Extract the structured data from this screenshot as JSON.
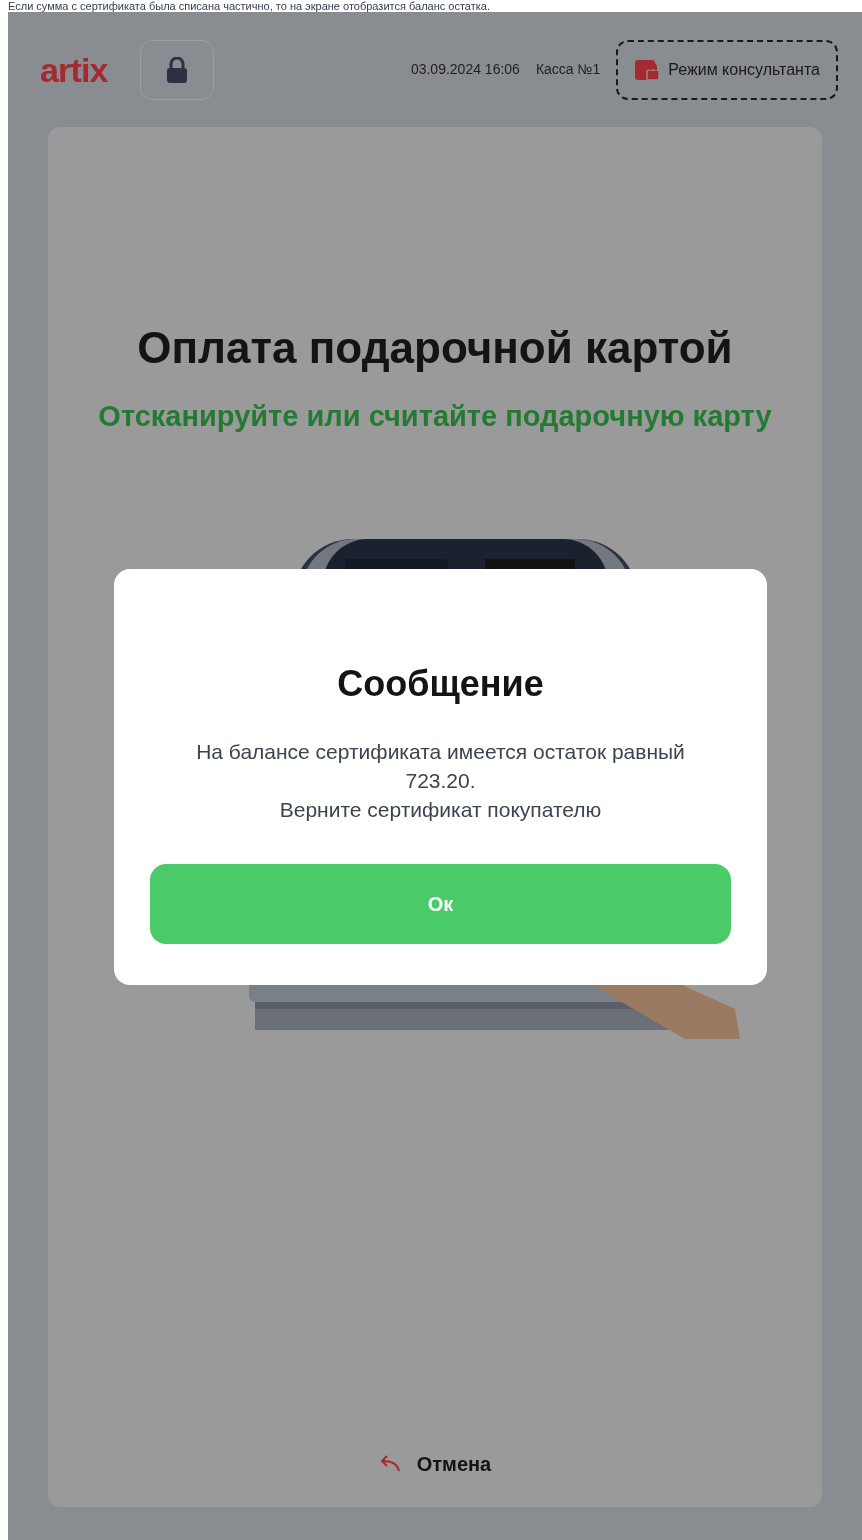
{
  "caption": "Если сумма с сертификата была списана частично, то на экране отобразится баланс остатка.",
  "header": {
    "logo": "artix",
    "datetime": "03.09.2024 16:06",
    "register": "Касса №1",
    "consultant_button": "Режим консультанта"
  },
  "screen": {
    "title": "Оплата подарочной картой",
    "subtitle": "Отсканируйте или считайте подарочную карту",
    "cancel": "Отмена"
  },
  "dialog": {
    "title": "Сообщение",
    "lines": [
      "На балансе сертификата имеется остаток равный",
      "723.20.",
      "Верните сертификат покупателю"
    ],
    "ok": "Ок"
  }
}
